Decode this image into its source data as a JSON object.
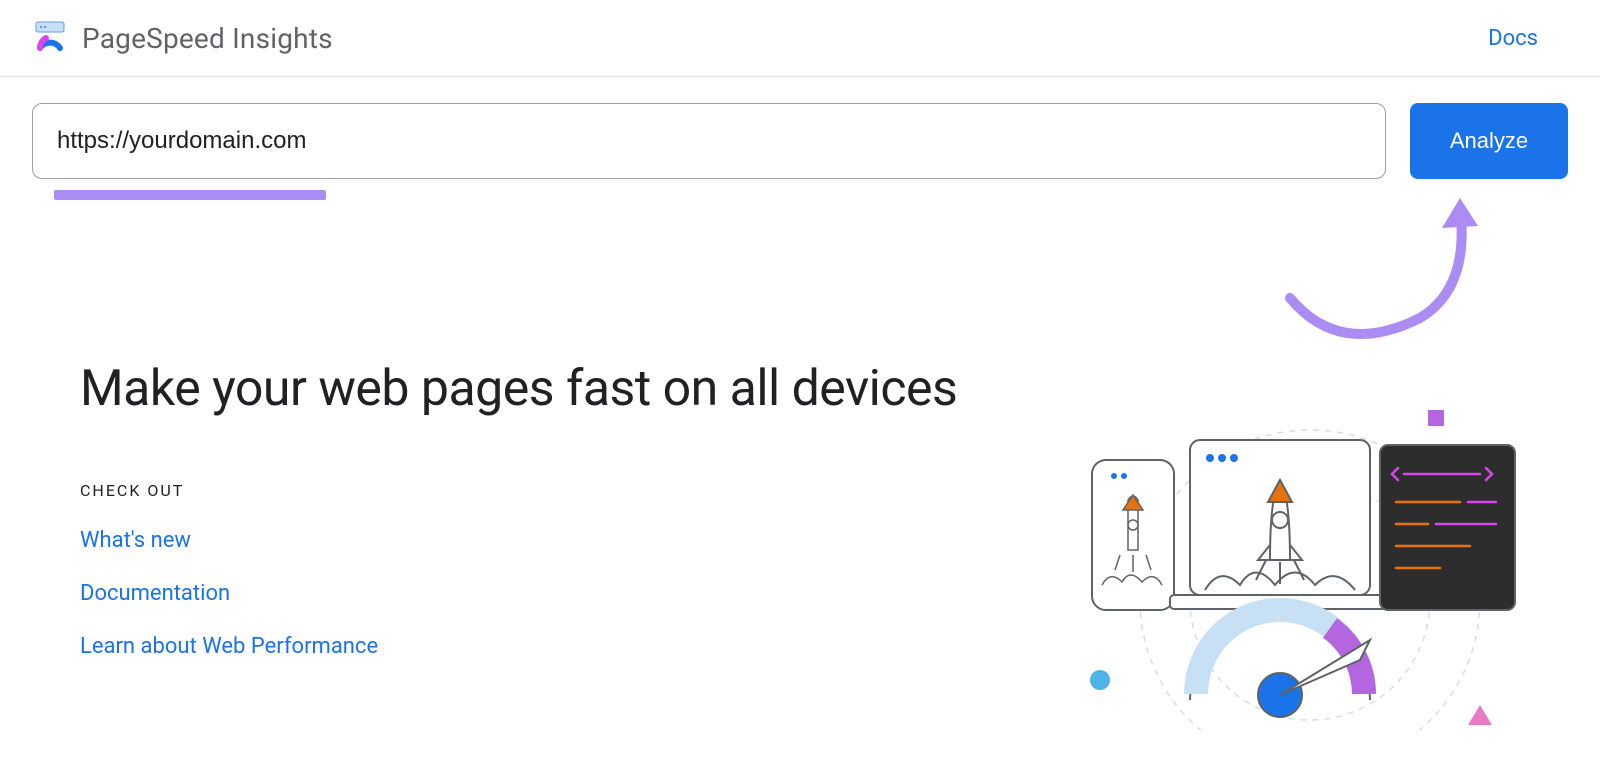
{
  "header": {
    "title": "PageSpeed Insights",
    "docs_label": "Docs"
  },
  "search": {
    "url_value": "https://yourdomain.com",
    "analyze_label": "Analyze"
  },
  "hero": {
    "title": "Make your web pages fast on all devices",
    "checkout_label": "CHECK OUT",
    "links": [
      "What's new",
      "Documentation",
      "Learn about Web Performance"
    ]
  },
  "colors": {
    "accent": "#1a73e8",
    "annotation": "#ab8cf2"
  }
}
